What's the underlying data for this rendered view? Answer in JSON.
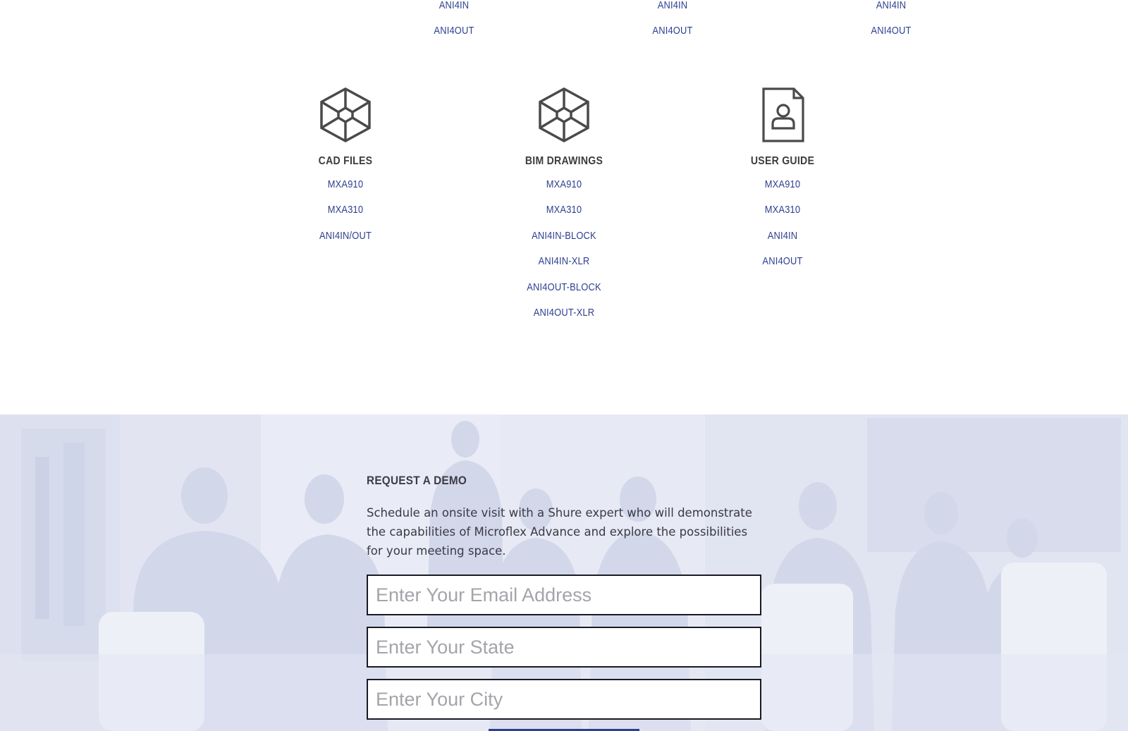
{
  "top_columns": [
    {
      "links": [
        "ANI4IN",
        "ANI4OUT"
      ]
    },
    {
      "links": [
        "ANI4IN",
        "ANI4OUT"
      ]
    },
    {
      "links": [
        "ANI4IN",
        "ANI4OUT"
      ]
    }
  ],
  "resources": [
    {
      "icon": "cube-icon",
      "heading": "CAD FILES",
      "links": [
        "MXA910",
        "MXA310",
        "ANI4IN/OUT"
      ]
    },
    {
      "icon": "cube-icon",
      "heading": "BIM DRAWINGS",
      "links": [
        "MXA910",
        "MXA310",
        "ANI4IN-BLOCK",
        "ANI4IN-XLR",
        "ANI4OUT-BLOCK",
        "ANI4OUT-XLR"
      ]
    },
    {
      "icon": "user-document-icon",
      "heading": "USER GUIDE",
      "links": [
        "MXA910",
        "MXA310",
        "ANI4IN",
        "ANI4OUT"
      ]
    }
  ],
  "demo": {
    "title": "REQUEST A DEMO",
    "description": "Schedule an onsite visit with a Shure expert who will demonstrate the capabilities of Microflex Advance and explore the possibilities for your meeting space.",
    "email_placeholder": "Enter Your Email Address",
    "state_placeholder": "Enter Your State",
    "city_placeholder": "Enter Your City"
  },
  "colors": {
    "link": "#2e3f8f",
    "heading": "#3d3d3d",
    "section_bg": "#e6e9f4",
    "icon_stroke": "#4a4a4a"
  }
}
